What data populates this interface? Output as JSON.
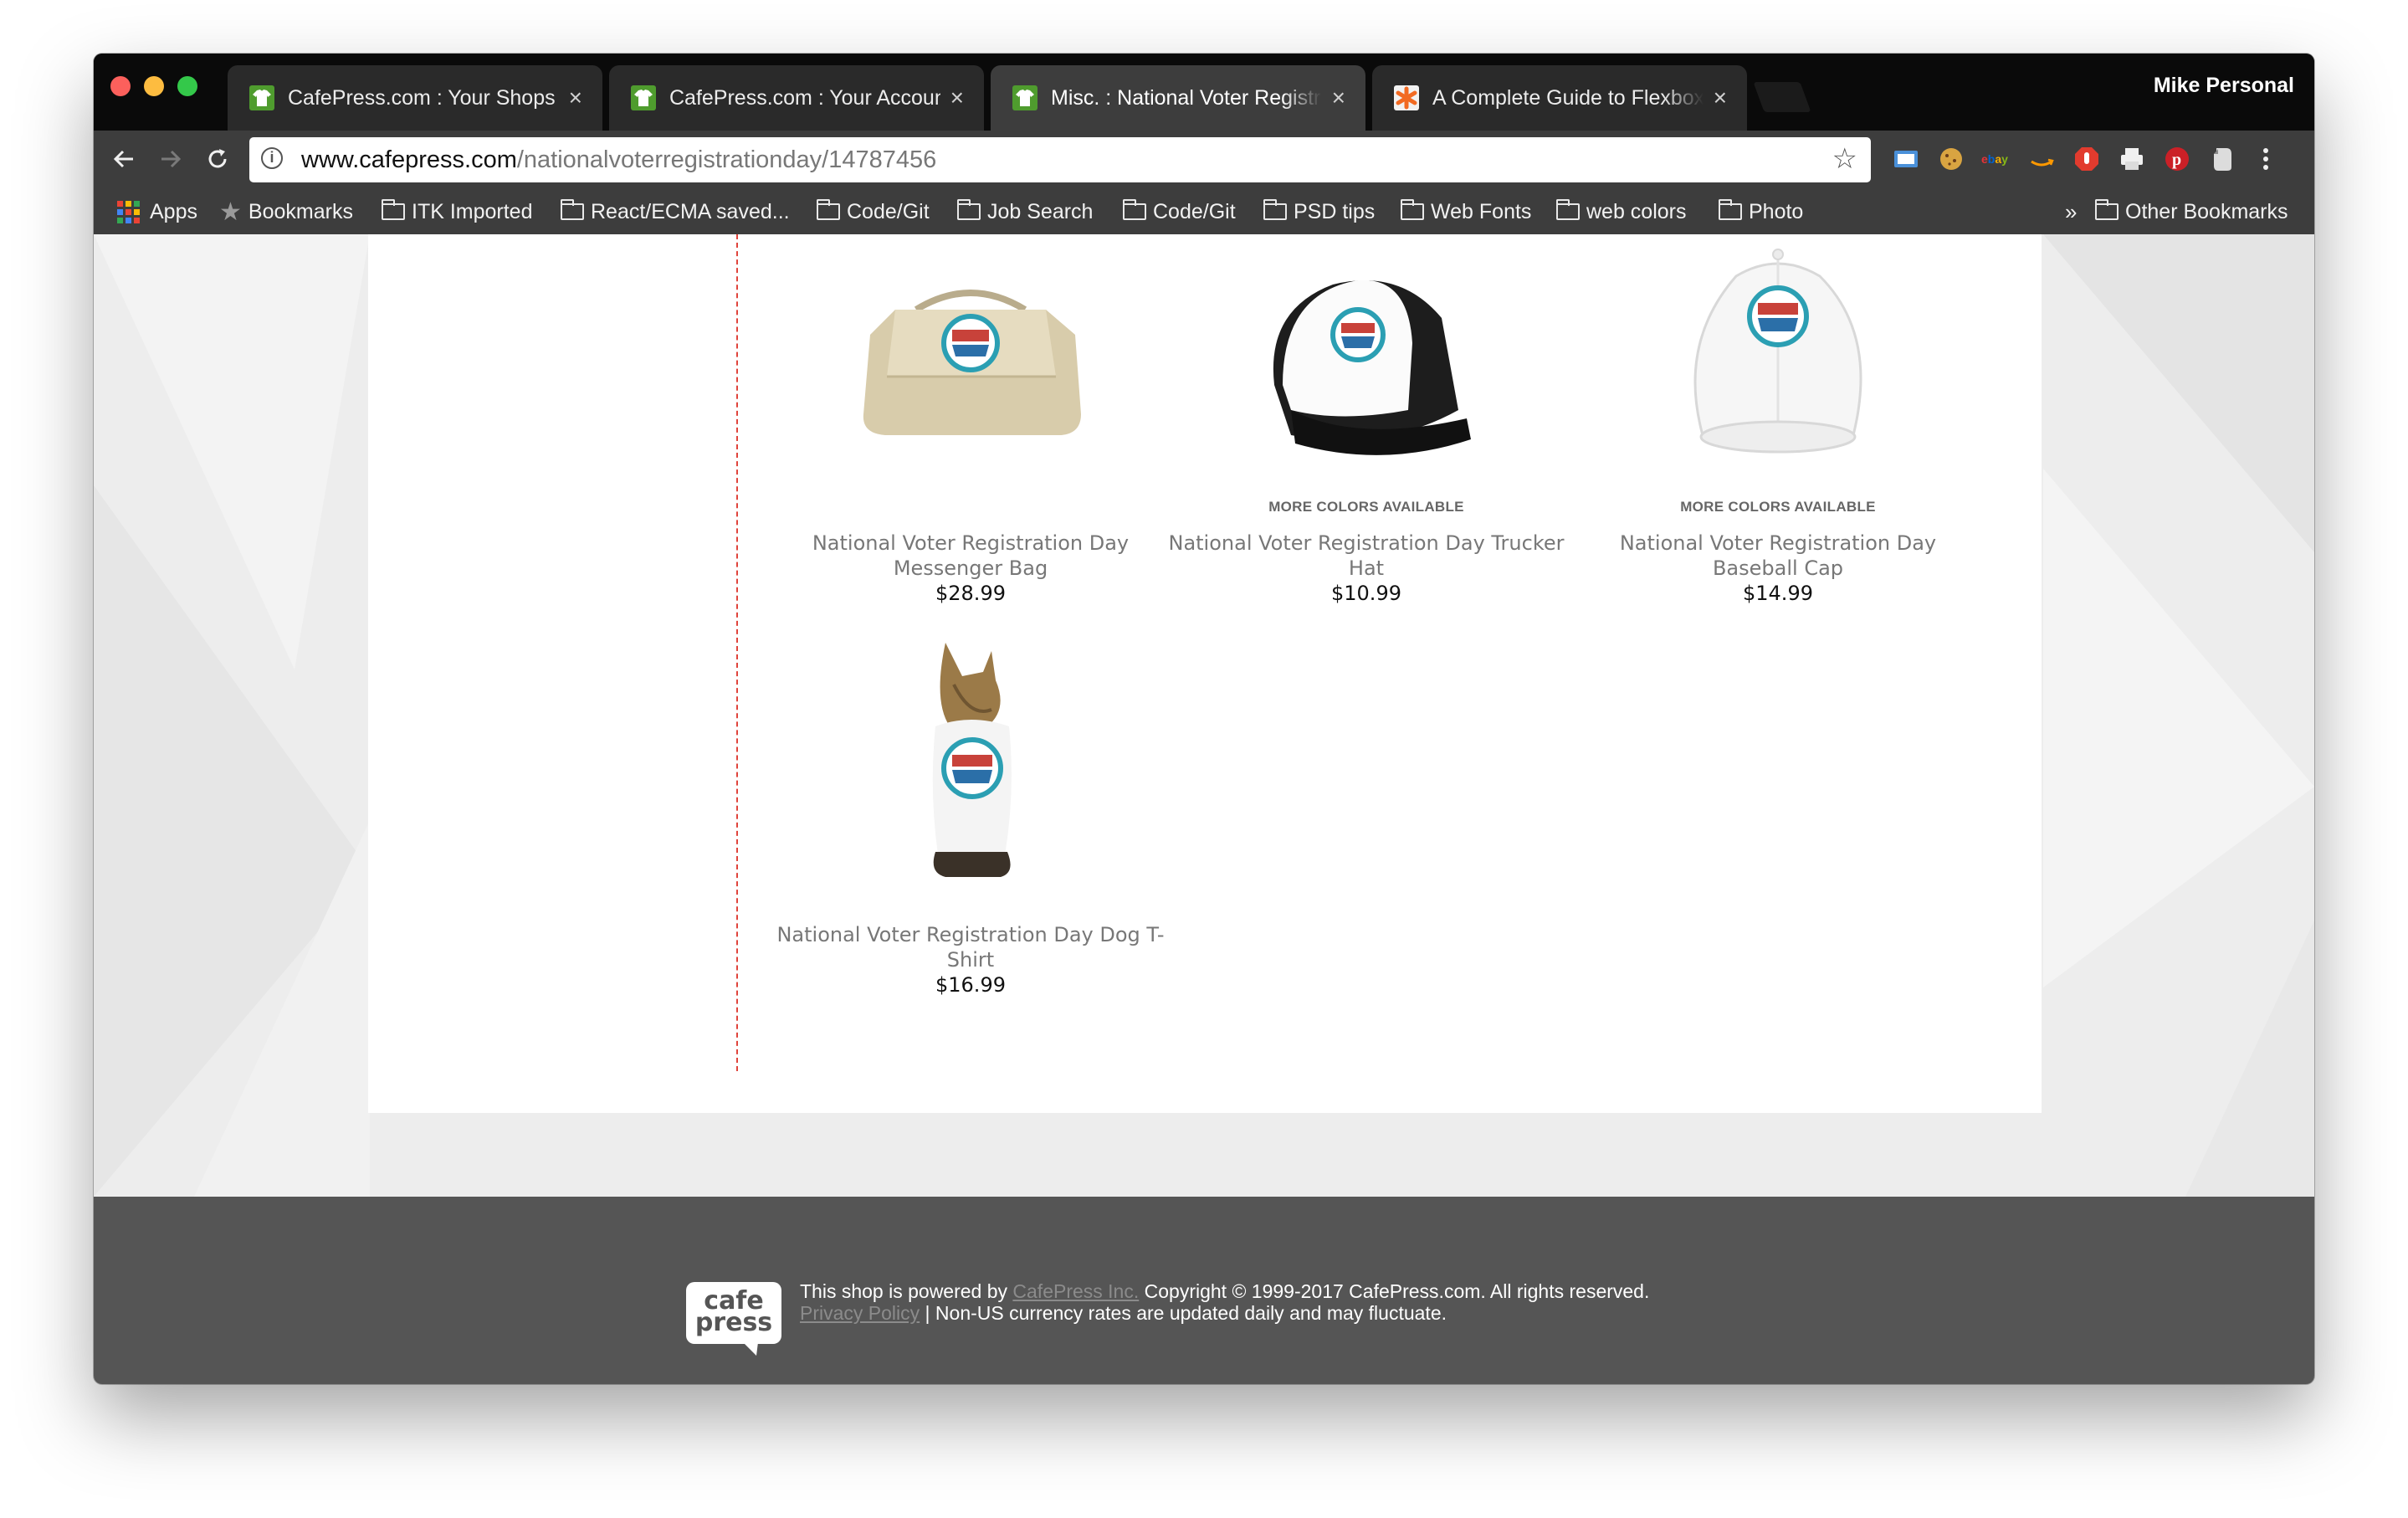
{
  "browser": {
    "tabs": [
      {
        "title": "CafePress.com : Your Shops",
        "favicon": "cafepress-shirt-icon",
        "active": false
      },
      {
        "title": "CafePress.com : Your Account",
        "favicon": "cafepress-shirt-icon",
        "active": false
      },
      {
        "title": "Misc. : National Voter Registrat",
        "favicon": "cafepress-shirt-icon",
        "active": true
      },
      {
        "title": "A Complete Guide to Flexbox |",
        "favicon": "css-tricks-asterisk-icon",
        "active": false
      }
    ],
    "tab_close_glyph": "×",
    "profile_name": "Mike Personal",
    "url_host": "www.cafepress.com",
    "url_path": "/nationalvoterregistrationday/14787456",
    "bookmarks": [
      {
        "label": "Apps",
        "icon": "apps-grid-icon"
      },
      {
        "label": "Bookmarks",
        "icon": "star-icon"
      },
      {
        "label": "ITK Imported",
        "icon": "folder-icon"
      },
      {
        "label": "React/ECMA saved...",
        "icon": "folder-icon"
      },
      {
        "label": "Code/Git",
        "icon": "folder-icon"
      },
      {
        "label": "Job Search",
        "icon": "folder-icon"
      },
      {
        "label": "Code/Git",
        "icon": "folder-icon"
      },
      {
        "label": "PSD tips",
        "icon": "folder-icon"
      },
      {
        "label": "Web Fonts",
        "icon": "folder-icon"
      },
      {
        "label": "web colors",
        "icon": "folder-icon"
      },
      {
        "label": "Photo",
        "icon": "folder-icon"
      }
    ],
    "bookmarks_overflow": "»",
    "other_bookmarks": "Other Bookmarks",
    "extensions": [
      "screen-capture-icon",
      "cookie-icon",
      "ebay-icon",
      "amazon-icon",
      "adblock-icon",
      "print-icon",
      "pinterest-icon",
      "evernote-icon",
      "menu-dots-icon"
    ]
  },
  "products": [
    {
      "name": "National Voter Registration Day Messenger Bag",
      "price": "$28.99",
      "badge": "",
      "image": "messenger-bag"
    },
    {
      "name": "National Voter Registration Day Trucker Hat",
      "price": "$10.99",
      "badge": "MORE COLORS AVAILABLE",
      "image": "trucker-hat"
    },
    {
      "name": "National Voter Registration Day Baseball Cap",
      "price": "$14.99",
      "badge": "MORE COLORS AVAILABLE",
      "image": "baseball-cap"
    },
    {
      "name": "National Voter Registration Day Dog T-Shirt",
      "price": "$16.99",
      "badge": "",
      "image": "dog-tshirt"
    }
  ],
  "footer": {
    "logo_text": "cafe press",
    "powered_prefix": "This shop is powered by ",
    "powered_link": "CafePress Inc.",
    "copyright": " Copyright © 1999-2017 CafePress.com. All rights reserved.",
    "privacy_link": "Privacy Policy",
    "currency_note": " | Non-US currency rates are updated daily and may fluctuate."
  },
  "colors": {
    "divider": "#e0443c",
    "footer_bg": "#555555",
    "link": "#8b8b8b",
    "cafepress_green": "#4f9c2e",
    "logo_red": "#c8423a",
    "logo_teal": "#2b9fb3"
  }
}
